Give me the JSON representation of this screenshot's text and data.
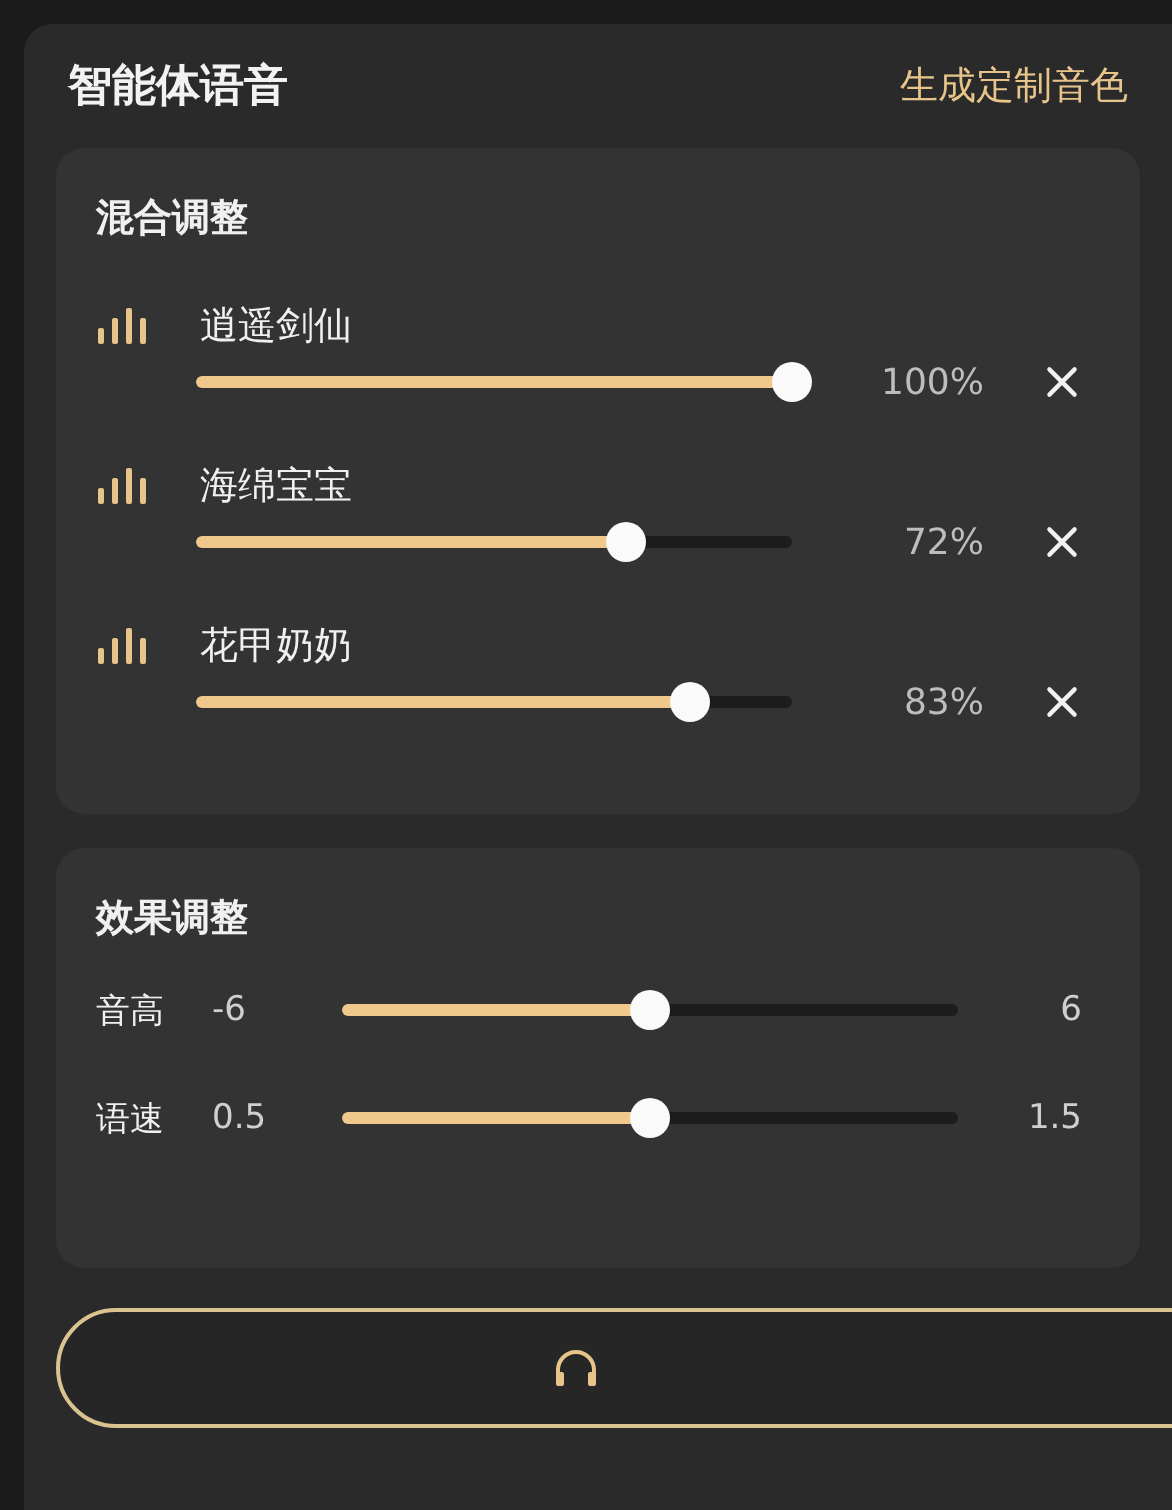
{
  "header": {
    "title": "智能体语音",
    "action": "生成定制音色"
  },
  "mix": {
    "title": "混合调整",
    "voices": [
      {
        "name": "逍遥剑仙",
        "level": 1.0,
        "reading": "100%"
      },
      {
        "name": "海绵宝宝",
        "level": 0.72,
        "reading": "72%"
      },
      {
        "name": "花甲奶奶",
        "level": 0.83,
        "reading": "83%"
      }
    ]
  },
  "effects": {
    "title": "效果调整",
    "sliders": [
      {
        "label": "音高",
        "min": "-6",
        "max": "6",
        "level": 0.5
      },
      {
        "label": "语速",
        "min": "0.5",
        "max": "1.5",
        "level": 0.5
      }
    ]
  },
  "bottom_button": {
    "kind": "outline"
  }
}
